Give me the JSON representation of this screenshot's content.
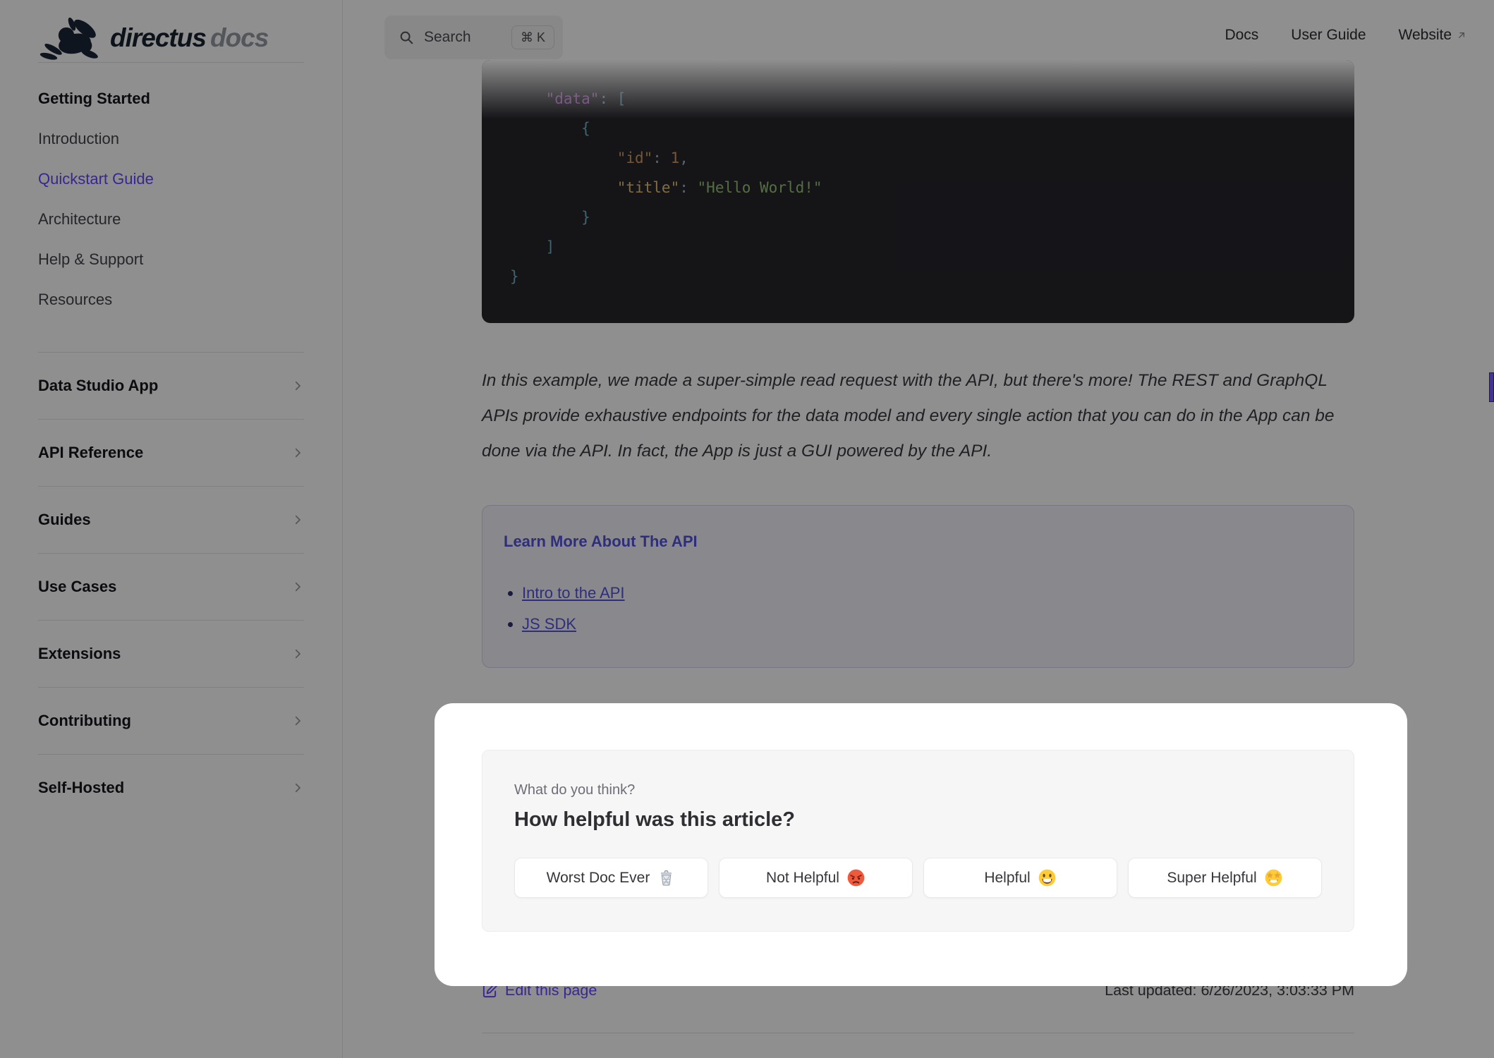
{
  "brand": {
    "name": "directus",
    "suffix": "docs"
  },
  "header": {
    "search": {
      "label": "Search",
      "shortcut": "⌘ K"
    },
    "nav": [
      {
        "label": "Docs",
        "external": false
      },
      {
        "label": "User Guide",
        "external": false
      },
      {
        "label": "Website",
        "external": true
      }
    ]
  },
  "sidebar": {
    "top_group": {
      "header": "Getting Started",
      "items": [
        {
          "label": "Introduction",
          "active": false
        },
        {
          "label": "Quickstart Guide",
          "active": true
        },
        {
          "label": "Architecture",
          "active": false
        },
        {
          "label": "Help & Support",
          "active": false
        },
        {
          "label": "Resources",
          "active": false
        }
      ]
    },
    "groups": [
      "Data Studio App",
      "API Reference",
      "Guides",
      "Use Cases",
      "Extensions",
      "Contributing",
      "Self-Hosted"
    ]
  },
  "content": {
    "code": {
      "lines": [
        [
          [
            "ws",
            "    "
          ],
          [
            "k1",
            "\"data\""
          ],
          [
            "pun",
            ": "
          ],
          [
            "brk",
            "["
          ]
        ],
        [
          [
            "ws",
            "        "
          ],
          [
            "brk",
            "{"
          ]
        ],
        [
          [
            "ws",
            "            "
          ],
          [
            "k2",
            "\"id\""
          ],
          [
            "pun",
            ": "
          ],
          [
            "num",
            "1"
          ],
          [
            "pun",
            ","
          ]
        ],
        [
          [
            "ws",
            "            "
          ],
          [
            "k3",
            "\"title\""
          ],
          [
            "pun",
            ": "
          ],
          [
            "str",
            "\"Hello World!\""
          ]
        ],
        [
          [
            "ws",
            "        "
          ],
          [
            "brk",
            "}"
          ]
        ],
        [
          [
            "ws",
            "    "
          ],
          [
            "brk",
            "]"
          ]
        ],
        [
          [
            "brk",
            "}"
          ]
        ]
      ]
    },
    "paragraph": "In this example, we made a super-simple read request with the API, but there's more! The REST and GraphQL APIs provide exhaustive endpoints for the data model and every single action that you can do in the App can be done via the API. In fact, the App is just a GUI powered by the API.",
    "learn_more": {
      "title": "Learn More About The API",
      "links": [
        "Intro to the API",
        "JS SDK"
      ]
    },
    "feedback": {
      "eyebrow": "What do you think?",
      "title": "How helpful was this article?",
      "buttons": [
        {
          "label": "Worst Doc Ever",
          "icon": "wastebasket-icon"
        },
        {
          "label": "Not Helpful",
          "icon": "enraged-face-icon"
        },
        {
          "label": "Helpful",
          "icon": "grinning-face-icon"
        },
        {
          "label": "Super Helpful",
          "icon": "star-struck-icon"
        }
      ]
    },
    "footer": {
      "edit_link": "Edit this page",
      "last_updated": "Last updated: 6/26/2023, 3:03:33 PM"
    }
  },
  "colors": {
    "brand": "#6644ff",
    "overlay": "rgba(0,0,0,0.44)",
    "code-bg": "#26262c",
    "code-key1": "#c678dd",
    "code-key2": "#d19a66",
    "code-key3": "#e5c07b",
    "code-str": "#98c379",
    "code-num": "#d19a66",
    "code-punc": "#9fb3c2",
    "code-brk": "#6fb3c7",
    "box-link": "#5552d9"
  }
}
